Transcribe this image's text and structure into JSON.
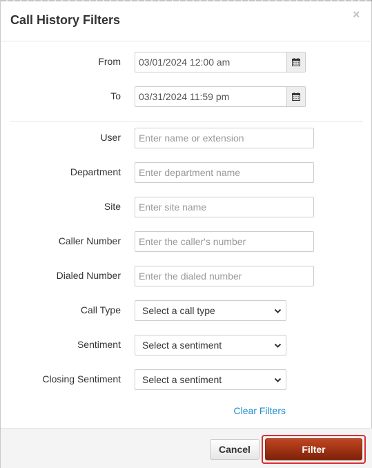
{
  "dialog": {
    "title": "Call History Filters",
    "close_glyph": "×"
  },
  "date_range": {
    "from_label": "From",
    "from_value": "03/01/2024 12:00 am",
    "to_label": "To",
    "to_value": "03/31/2024 11:59 pm",
    "icon": "calendar-icon"
  },
  "filters": {
    "user": {
      "label": "User",
      "placeholder": "Enter name or extension"
    },
    "department": {
      "label": "Department",
      "placeholder": "Enter department name"
    },
    "site": {
      "label": "Site",
      "placeholder": "Enter site name"
    },
    "caller_number": {
      "label": "Caller Number",
      "placeholder": "Enter the caller's number"
    },
    "dialed_number": {
      "label": "Dialed Number",
      "placeholder": "Enter the dialed number"
    },
    "call_type": {
      "label": "Call Type",
      "selected": "Select a call type"
    },
    "sentiment": {
      "label": "Sentiment",
      "selected": "Select a sentiment"
    },
    "closing_sentiment": {
      "label": "Closing Sentiment",
      "selected": "Select a sentiment"
    }
  },
  "clear_filters_label": "Clear Filters",
  "footer": {
    "cancel_label": "Cancel",
    "filter_label": "Filter"
  },
  "colors": {
    "link": "#1a8ccb",
    "primary_button": "#9c3114",
    "highlight_border": "#d92d33"
  }
}
